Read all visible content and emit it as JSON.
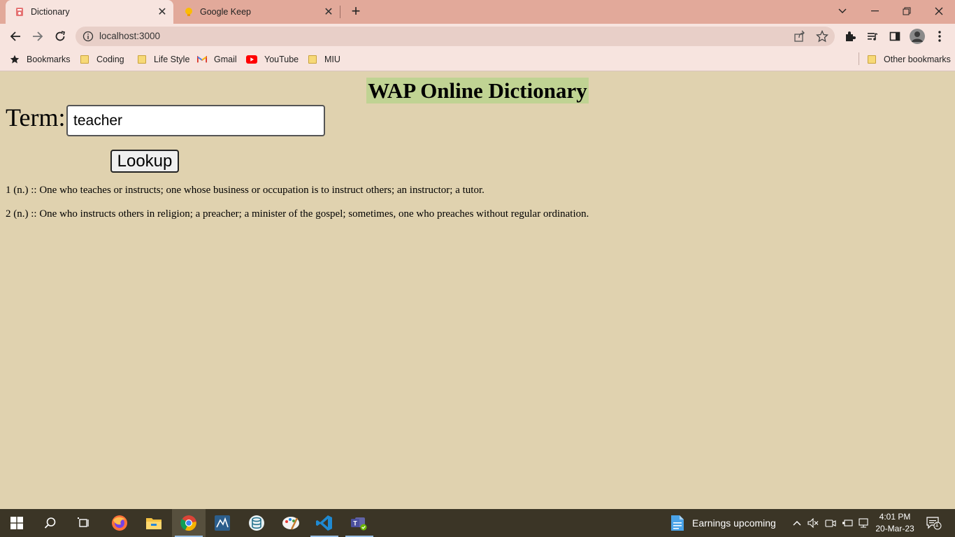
{
  "browser": {
    "tabs": [
      {
        "title": "Dictionary",
        "icon": "dictionary-favicon",
        "active": true
      },
      {
        "title": "Google Keep",
        "icon": "google-keep-favicon",
        "active": false
      }
    ],
    "url": "localhost:3000",
    "bookmarks": [
      {
        "label": "Bookmarks",
        "icon": "star-icon"
      },
      {
        "label": "Coding",
        "icon": "folder-icon"
      },
      {
        "label": "Life Style",
        "icon": "folder-icon"
      },
      {
        "label": "Gmail",
        "icon": "gmail-icon"
      },
      {
        "label": "YouTube",
        "icon": "youtube-icon"
      },
      {
        "label": "MIU",
        "icon": "folder-icon"
      }
    ],
    "other_bookmarks": "Other bookmarks"
  },
  "page": {
    "heading": "WAP Online Dictionary",
    "term_label": "Term:",
    "term_value": "teacher",
    "lookup_label": "Lookup",
    "definitions": [
      "1 (n.) :: One who teaches or instructs; one whose business or occupation is to instruct others; an instructor; a tutor.",
      "2 (n.) :: One who instructs others in religion; a preacher; a minister of the gospel; sometimes, one who preaches without regular ordination."
    ]
  },
  "taskbar": {
    "apps": [
      "start-icon",
      "search-icon",
      "task-view-icon",
      "firefox-icon",
      "file-explorer-icon",
      "chrome-icon",
      "mysql-workbench-icon",
      "database-icon",
      "paint-icon",
      "vscode-icon",
      "teams-icon"
    ],
    "weather_text": "Earnings upcoming",
    "time": "4:01 PM",
    "date": "20-Mar-23",
    "notification_count": "1"
  },
  "colors": {
    "page_background": "#e0d2af",
    "heading_highlight": "#c0d393",
    "tabstrip": "#e2a99a",
    "toolbar": "#f7e4df",
    "taskbar": "#3b3526"
  }
}
